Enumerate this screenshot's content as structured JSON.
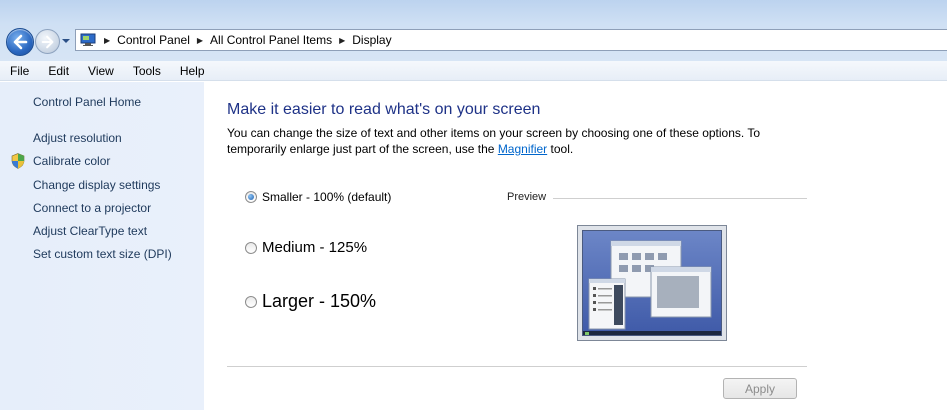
{
  "address": {
    "crumbs": [
      "Control Panel",
      "All Control Panel Items",
      "Display"
    ]
  },
  "menu": [
    "File",
    "Edit",
    "View",
    "Tools",
    "Help"
  ],
  "sidebar": {
    "home": "Control Panel Home",
    "links": [
      "Adjust resolution",
      "Calibrate color",
      "Change display settings",
      "Connect to a projector",
      "Adjust ClearType text",
      "Set custom text size (DPI)"
    ]
  },
  "main": {
    "heading": "Make it easier to read what's on your screen",
    "desc_part1": "You can change the size of text and other items on your screen by choosing one of these options. To temporarily enlarge just part of the screen, use the ",
    "desc_link": "Magnifier",
    "desc_part2": " tool.",
    "options": [
      {
        "label": "Smaller - 100% (default)",
        "selected": true
      },
      {
        "label": "Medium - 125%",
        "selected": false
      },
      {
        "label": "Larger - 150%",
        "selected": false
      }
    ],
    "preview_label": "Preview",
    "apply_label": "Apply"
  },
  "colors": {
    "heading": "#1e3287",
    "link": "#0066cc",
    "sidebar_bg": "#e6eefa",
    "sidebar_text": "#1e395b"
  }
}
